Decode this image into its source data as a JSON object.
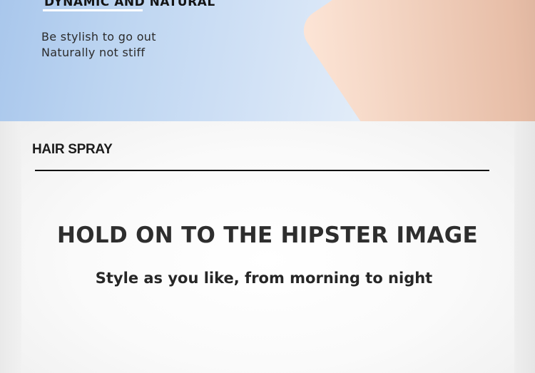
{
  "hero": {
    "heading": "DYNAMIC AND NATURAL",
    "tagline_1": "Be stylish to go out",
    "tagline_2": "Naturally not stiff"
  },
  "section": {
    "label": "HAIR SPRAY",
    "headline": "HOLD ON TO THE HIPSTER IMAGE",
    "subline": "Style as you like, from morning to night"
  },
  "colors": {
    "hero_blue": "#bdd5f1",
    "panel_bg": "#fafafa",
    "text_dark": "#2e2e2e",
    "divider": "#111111"
  }
}
